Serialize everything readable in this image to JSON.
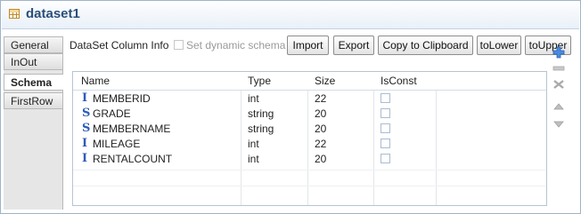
{
  "window": {
    "title": "dataset1"
  },
  "tabs": [
    {
      "label": "General",
      "active": false
    },
    {
      "label": "InOut",
      "active": false
    },
    {
      "label": "Schema",
      "active": true
    },
    {
      "label": "FirstRow",
      "active": false
    }
  ],
  "toolbar": {
    "info_label": "DataSet Column Info",
    "dynamic_schema_label": "Set dynamic schema",
    "dynamic_schema_checked": false,
    "import_label": "Import",
    "export_label": "Export",
    "clipboard_label": "Copy to Clipboard",
    "tolower_label": "toLower",
    "toupper_label": "toUpper"
  },
  "grid": {
    "headers": [
      "Name",
      "Type",
      "Size",
      "IsConst"
    ],
    "rows": [
      {
        "icon": "integer-type-icon",
        "glyph": "I",
        "name": "MEMBERID",
        "type": "int",
        "size": "22",
        "isconst": false
      },
      {
        "icon": "string-type-icon",
        "glyph": "S",
        "name": "GRADE",
        "type": "string",
        "size": "20",
        "isconst": false
      },
      {
        "icon": "string-type-icon",
        "glyph": "S",
        "name": "MEMBERNAME",
        "type": "string",
        "size": "20",
        "isconst": false
      },
      {
        "icon": "integer-type-icon",
        "glyph": "I",
        "name": "MILEAGE",
        "type": "int",
        "size": "22",
        "isconst": false
      },
      {
        "icon": "integer-type-icon",
        "glyph": "I",
        "name": "RENTALCOUNT",
        "type": "int",
        "size": "20",
        "isconst": false
      }
    ]
  },
  "side_actions": [
    "add-row-icon",
    "remove-row-icon",
    "delete-all-icon",
    "move-up-icon",
    "move-down-icon"
  ],
  "colors": {
    "title": "#2a4f7a",
    "type_icon": "#2d5bb8",
    "add_icon": "#3a7bd5"
  }
}
